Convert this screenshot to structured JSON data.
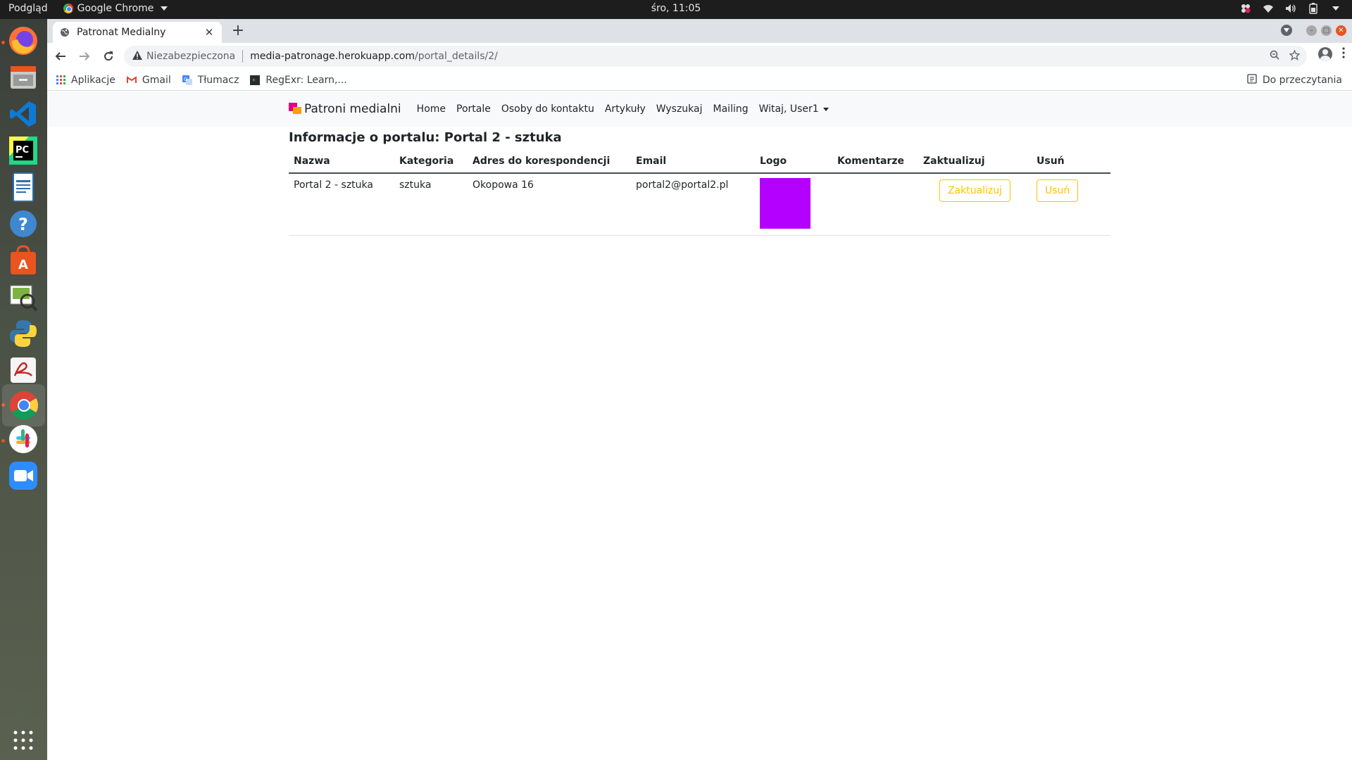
{
  "system": {
    "preview_label": "Podgląd",
    "app_name": "Google Chrome",
    "clock": "śro, 11:05"
  },
  "browser": {
    "tab_title": "Patronat Medialny",
    "insecure_label": "Niezabezpieczona",
    "url_host": "media-patronage.herokuapp.com",
    "url_path": "/portal_details/2/",
    "bookmarks": [
      "Aplikacje",
      "Gmail",
      "Tłumacz",
      "RegExr: Learn,..."
    ],
    "reading_list": "Do przeczytania"
  },
  "site": {
    "brand": "Patroni medialni",
    "nav": [
      "Home",
      "Portale",
      "Osoby do kontaktu",
      "Artykuły",
      "Wyszukaj",
      "Mailing"
    ],
    "user_menu": "Witaj, User1",
    "brand_colors": {
      "primary": "#e6007e",
      "secondary": "#f5a300"
    }
  },
  "main": {
    "heading_prefix": "Informacje o portalu:",
    "heading_name": "Portal 2 - sztuka",
    "columns": [
      "Nazwa",
      "Kategoria",
      "Adres do korespondencji",
      "Email",
      "Logo",
      "Komentarze",
      "Zaktualizuj",
      "Usuń"
    ],
    "row": {
      "name": "Portal 2 - sztuka",
      "category": "sztuka",
      "address": "Okopowa 16",
      "email": "portal2@portal2.pl",
      "logo_color": "#b300ff",
      "comments": "",
      "update_label": "Zaktualizuj",
      "delete_label": "Usuń"
    },
    "button_color": "#ffc107"
  }
}
